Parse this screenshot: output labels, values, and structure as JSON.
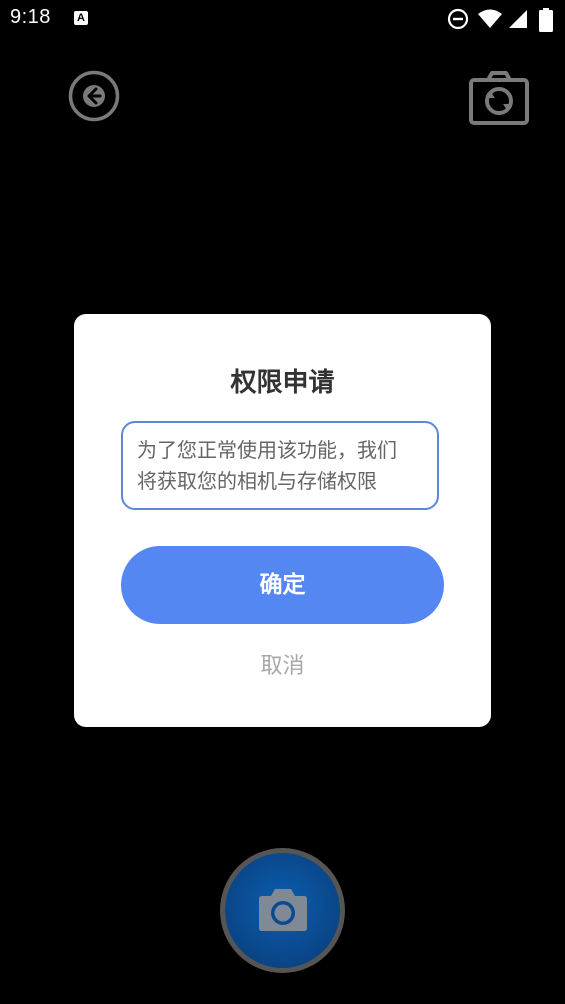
{
  "status_bar": {
    "time": "9:18",
    "notification_icon": "a-icon",
    "a_icon_glyph": "A",
    "icons": [
      "do-not-disturb-icon",
      "wifi-icon",
      "signal-icon",
      "battery-icon"
    ]
  },
  "top_bar": {
    "back_icon": "back-arrow-icon",
    "switch_camera_icon": "switch-camera-icon"
  },
  "dialog": {
    "title": "权限申请",
    "message_line1": "为了您正常使用该功能，我们",
    "message_line2": "将获取您的相机与存储权限",
    "confirm_label": "确定",
    "cancel_label": "取消"
  },
  "shutter": {
    "icon": "camera-icon"
  },
  "colors": {
    "accent": "#5487f2",
    "border": "#5b89d8",
    "background": "#000000",
    "shutter": "#0a4a8f"
  }
}
